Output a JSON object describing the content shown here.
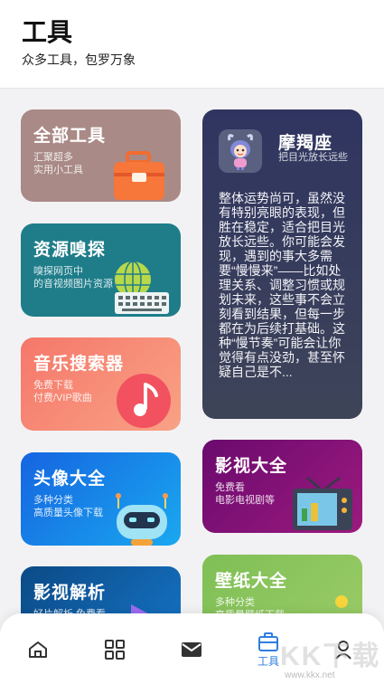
{
  "header": {
    "title": "工具",
    "subtitle": "众多工具，包罗万象"
  },
  "cards": [
    {
      "title": "全部工具",
      "desc": "汇聚超多\n实用小工具",
      "icon": "toolbox-icon"
    },
    {
      "title": "资源嗅探",
      "desc": "嗅探网页中\n的音视频图片资源",
      "icon": "globe-keyboard-icon"
    },
    {
      "title": "音乐搜索器",
      "desc": "免费下载\n付费/VIP歌曲",
      "icon": "music-note-icon"
    },
    {
      "title": "头像大全",
      "desc": "多种分类\n高质量头像下载",
      "icon": "robot-icon"
    },
    {
      "title": "影视解析",
      "desc": "好片解析 免费看",
      "icon": "play-icon"
    },
    {
      "title": "影视大全",
      "desc": "免费看\n电影电视剧等",
      "icon": "tv-icon"
    },
    {
      "title": "壁纸大全",
      "desc": "多种分类\n高质量壁纸下载",
      "icon": "wallpaper-icon"
    }
  ],
  "horoscope": {
    "title": "摩羯座",
    "subtitle": "把目光放长远些",
    "body": "整体运势尚可，虽然没有特别亮眼的表现，但胜在稳定，适合把目光放长远些。你可能会发现，遇到的事大多需要“慢慢来”——比如处理关系、调整习惯或规划未来，这些事不会立刻看到结果，但每一步都在为后续打基础。这种“慢节奏”可能会让你觉得有点没劲，甚至怀疑自己是不..."
  },
  "tabs": [
    {
      "label": "",
      "icon": "home-icon"
    },
    {
      "label": "",
      "icon": "grid-icon"
    },
    {
      "label": "",
      "icon": "mail-icon"
    },
    {
      "label": "工具",
      "icon": "toolbox-tab-icon",
      "active": true
    },
    {
      "label": "",
      "icon": "user-icon"
    }
  ],
  "watermark": {
    "text": "KK下载",
    "url": "www.kkx.net"
  },
  "colors": {
    "accent": "#2f7de0",
    "background": "#f2f2f4"
  }
}
